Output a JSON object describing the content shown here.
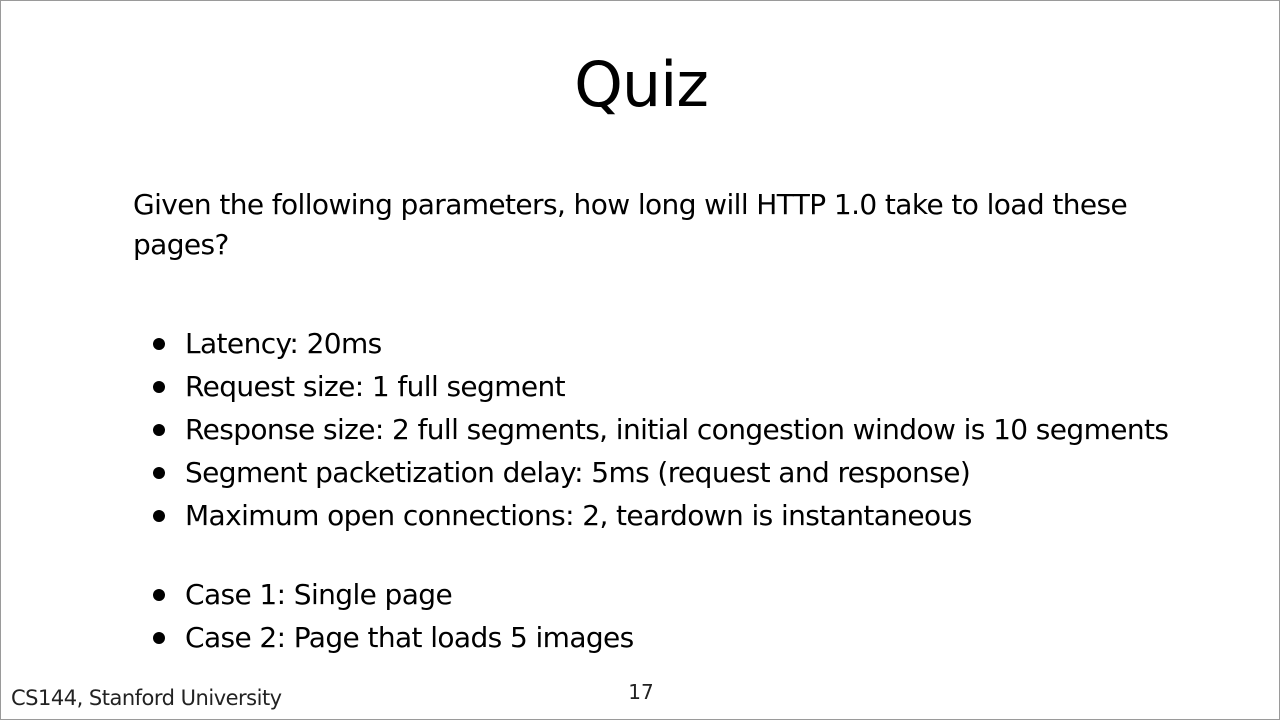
{
  "slide": {
    "title": "Quiz",
    "intro": "Given the following parameters, how long will HTTP 1.0 take to load these pages?",
    "parameters": [
      "Latency: 20ms",
      "Request size: 1 full segment",
      "Response size: 2 full segments, initial congestion window is 10 segments",
      "Segment packetization delay: 5ms (request and response)",
      "Maximum open connections: 2, teardown is instantaneous"
    ],
    "cases": [
      "Case 1: Single page",
      "Case 2: Page that loads 5 images"
    ],
    "footer": "CS144, Stanford University",
    "page_number": "17"
  }
}
